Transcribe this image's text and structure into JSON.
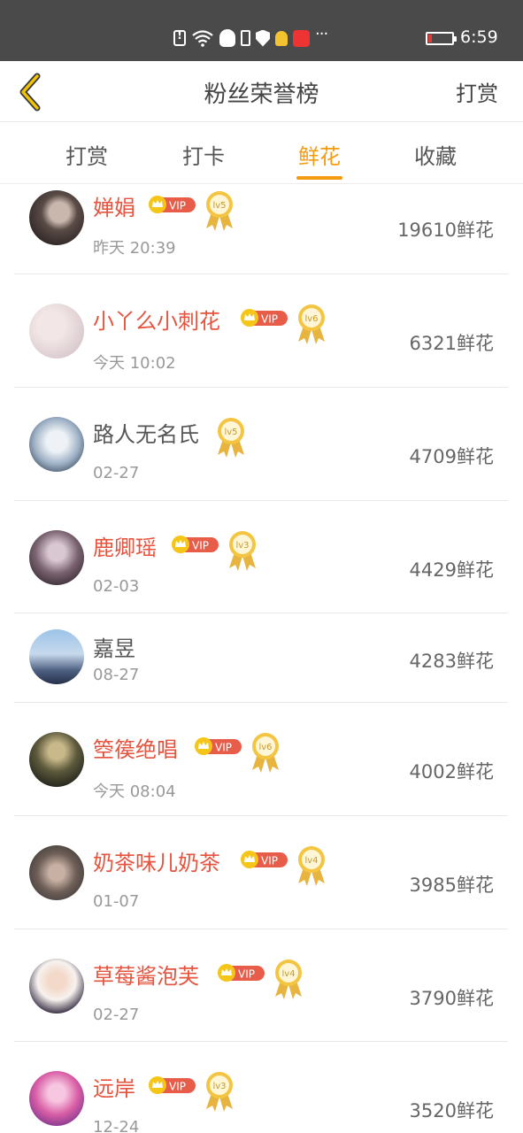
{
  "status_bar": {
    "time": "6:59",
    "icons": [
      "sim-alert-icon",
      "wifi-icon",
      "qq-icon",
      "phone-icon",
      "shield-icon",
      "bulb-icon",
      "app-icon",
      "more-icon"
    ],
    "battery_color": "#e53935"
  },
  "header": {
    "title": "粉丝荣誉榜",
    "right_label": "打赏",
    "back_icon": "chevron-left-icon",
    "accent": "#f3c400"
  },
  "tabs": [
    {
      "label": "打赏",
      "active": false
    },
    {
      "label": "打卡",
      "active": false
    },
    {
      "label": "鲜花",
      "active": true
    },
    {
      "label": "收藏",
      "active": false
    }
  ],
  "tab_accent": "#f39c12",
  "vip_text": "VIP",
  "fans": [
    {
      "name": "婵娟",
      "vip": true,
      "level": "lv5",
      "time": "昨天 20:39",
      "count": "19610鲜花"
    },
    {
      "name": "小丫么小刺花",
      "vip": true,
      "level": "lv6",
      "time": "今天 10:02",
      "count": "6321鲜花"
    },
    {
      "name": "路人无名氏",
      "vip": false,
      "level": "lv5",
      "time": "02-27",
      "count": "4709鲜花"
    },
    {
      "name": "鹿卿瑶",
      "vip": true,
      "level": "lv3",
      "time": "02-03",
      "count": "4429鲜花"
    },
    {
      "name": "嘉昱",
      "vip": false,
      "level": "",
      "time": "08-27",
      "count": "4283鲜花"
    },
    {
      "name": "箜篌绝唱",
      "vip": true,
      "level": "lv6",
      "time": "今天 08:04",
      "count": "4002鲜花"
    },
    {
      "name": "奶茶味儿奶茶",
      "vip": true,
      "level": "lv4",
      "time": "01-07",
      "count": "3985鲜花"
    },
    {
      "name": "草莓酱泡芙",
      "vip": true,
      "level": "lv4",
      "time": "02-27",
      "count": "3790鲜花"
    },
    {
      "name": "远岸",
      "vip": true,
      "level": "lv3",
      "time": "12-24",
      "count": "3520鲜花"
    }
  ]
}
